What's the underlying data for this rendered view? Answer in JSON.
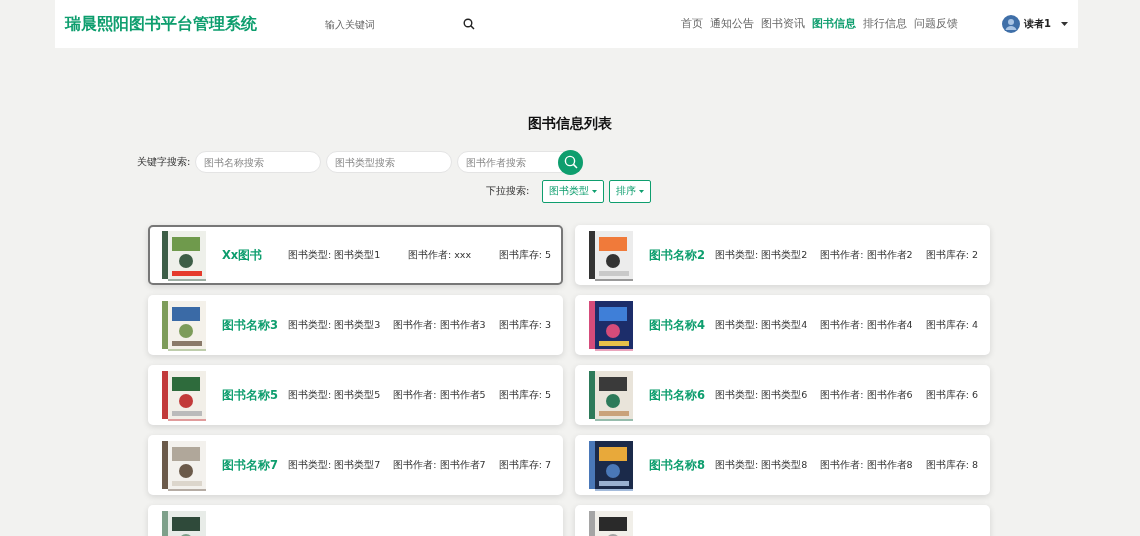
{
  "header": {
    "logo": "瑞晨熙阳图书平台管理系统",
    "search": {
      "placeholder": "输入关键词"
    },
    "nav": [
      {
        "label": "首页",
        "selected": false
      },
      {
        "label": "通知公告",
        "selected": false
      },
      {
        "label": "图书资讯",
        "selected": false
      },
      {
        "label": "图书信息",
        "selected": true
      },
      {
        "label": "排行信息",
        "selected": false
      },
      {
        "label": "问题反馈",
        "selected": false
      }
    ],
    "user": {
      "name": "读者1"
    }
  },
  "title": "图书信息列表",
  "keyword_search": {
    "label": "关键字搜索:",
    "fields": [
      {
        "placeholder": "图书名称搜索"
      },
      {
        "placeholder": "图书类型搜索"
      },
      {
        "placeholder": "图书作者搜索"
      }
    ]
  },
  "dropdown_search": {
    "label": "下拉搜索:",
    "buttons": [
      "图书类型",
      "排序"
    ]
  },
  "books": [
    {
      "kind": "picture",
      "highlighted": true,
      "name": "Xx图书",
      "type": "图书类型: 图书类型1",
      "author": "图书作者: xxx",
      "stock": "图书库存: 5"
    },
    {
      "kind": "picture",
      "highlighted": false,
      "name": "图书名称2",
      "type": "图书类型: 图书类型2",
      "author": "图书作者: 图书作者2",
      "stock": "图书库存: 2"
    },
    {
      "kind": "picture",
      "highlighted": false,
      "name": "图书名称3",
      "type": "图书类型: 图书类型3",
      "author": "图书作者: 图书作者3",
      "stock": "图书库存: 3"
    },
    {
      "kind": "picture",
      "highlighted": false,
      "name": "图书名称4",
      "type": "图书类型: 图书类型4",
      "author": "图书作者: 图书作者4",
      "stock": "图书库存: 4"
    },
    {
      "kind": "picture",
      "highlighted": false,
      "name": "图书名称5",
      "type": "图书类型: 图书类型5",
      "author": "图书作者: 图书作者5",
      "stock": "图书库存: 5"
    },
    {
      "kind": "picture",
      "highlighted": false,
      "name": "图书名称6",
      "type": "图书类型: 图书类型6",
      "author": "图书作者: 图书作者6",
      "stock": "图书库存: 6"
    },
    {
      "kind": "picture",
      "highlighted": false,
      "name": "图书名称7",
      "type": "图书类型: 图书类型7",
      "author": "图书作者: 图书作者7",
      "stock": "图书库存: 7"
    },
    {
      "kind": "picture",
      "highlighted": false,
      "name": "图书名称8",
      "type": "图书类型: 图书类型8",
      "author": "图书作者: 图书作者8",
      "stock": "图书库存: 8"
    },
    {
      "kind": "picture",
      "highlighted": false
    },
    {
      "kind": "picture",
      "highlighted": false
    }
  ]
}
